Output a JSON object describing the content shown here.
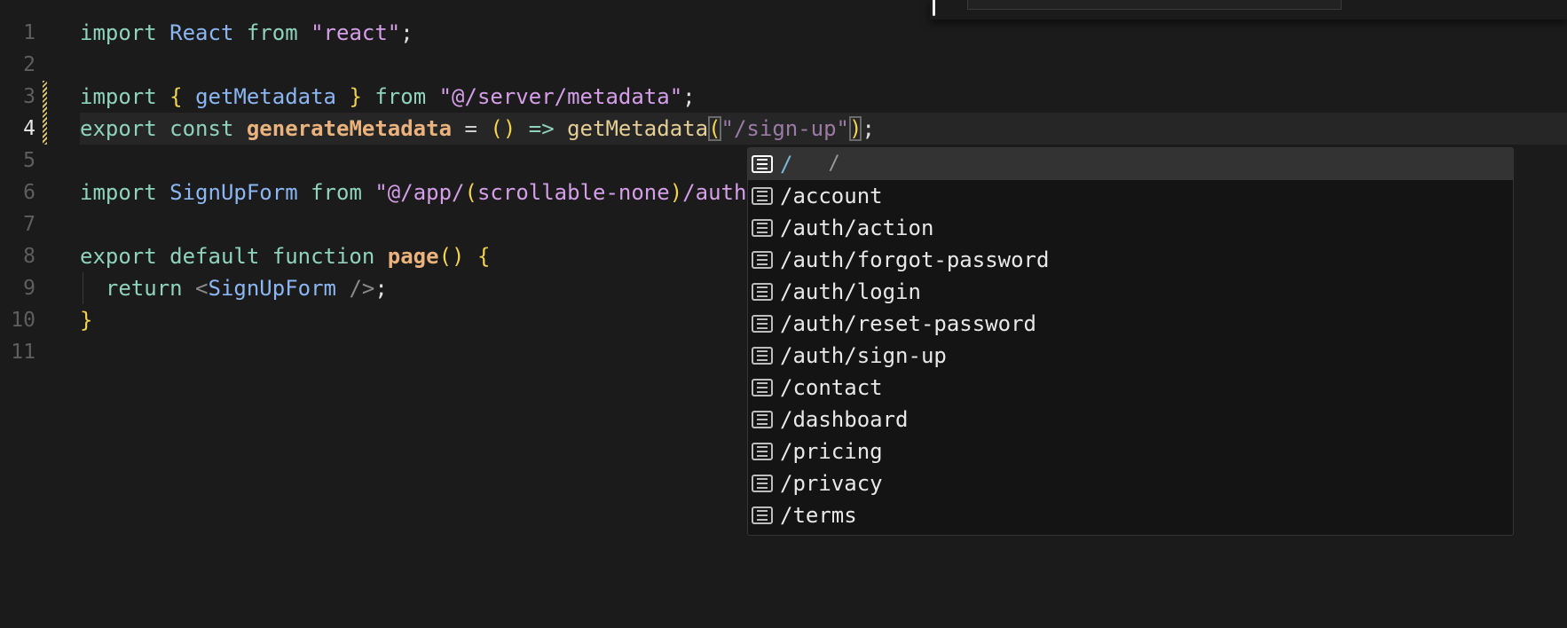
{
  "editor": {
    "line_numbers": [
      "1",
      "2",
      "3",
      "4",
      "5",
      "6",
      "7",
      "8",
      "9",
      "10",
      "11"
    ],
    "active_line": 4,
    "lines": [
      [
        {
          "t": "import ",
          "c": "kw"
        },
        {
          "t": "React ",
          "c": "id"
        },
        {
          "t": "from ",
          "c": "kw"
        },
        {
          "t": "\"react\"",
          "c": "str"
        },
        {
          "t": ";",
          "c": "pun"
        }
      ],
      [],
      [
        {
          "t": "import ",
          "c": "kw"
        },
        {
          "t": "{ ",
          "c": "br"
        },
        {
          "t": "getMetadata ",
          "c": "id"
        },
        {
          "t": "} ",
          "c": "br"
        },
        {
          "t": "from ",
          "c": "kw"
        },
        {
          "t": "\"@/server/metadata\"",
          "c": "str"
        },
        {
          "t": ";",
          "c": "pun"
        }
      ],
      [
        {
          "t": "export const ",
          "c": "kw"
        },
        {
          "t": "generateMetadata",
          "c": "fn"
        },
        {
          "t": " = ",
          "c": "op"
        },
        {
          "t": "() ",
          "c": "br"
        },
        {
          "t": "=> ",
          "c": "kw"
        },
        {
          "t": "getMetadata",
          "c": "call"
        },
        {
          "t": "(",
          "c": "br box"
        },
        {
          "t": "\"/sign-up\"",
          "c": "str-dim"
        },
        {
          "t": ")",
          "c": "br box"
        },
        {
          "t": ";",
          "c": "pun"
        }
      ],
      [],
      [
        {
          "t": "import ",
          "c": "kw"
        },
        {
          "t": "SignUpForm ",
          "c": "id"
        },
        {
          "t": "from ",
          "c": "kw"
        },
        {
          "t": "\"@/app/",
          "c": "str"
        },
        {
          "t": "(",
          "c": "br"
        },
        {
          "t": "scrollable-none",
          "c": "str"
        },
        {
          "t": ")",
          "c": "br"
        },
        {
          "t": "/auth",
          "c": "str"
        }
      ],
      [],
      [
        {
          "t": "export default function ",
          "c": "kw"
        },
        {
          "t": "page",
          "c": "fn"
        },
        {
          "t": "() ",
          "c": "br"
        },
        {
          "t": "{",
          "c": "br"
        }
      ],
      [
        {
          "t": "  return ",
          "c": "kw"
        },
        {
          "t": "<",
          "c": "tag"
        },
        {
          "t": "SignUpForm ",
          "c": "id"
        },
        {
          "t": "/>",
          "c": "tag"
        },
        {
          "t": ";",
          "c": "pun"
        }
      ],
      [
        {
          "t": "}",
          "c": "br"
        }
      ],
      []
    ]
  },
  "suggestions": {
    "icon": "text-document-icon",
    "selected": {
      "label": "/",
      "detail": "/"
    },
    "items": [
      "/account",
      "/auth/action",
      "/auth/forgot-password",
      "/auth/login",
      "/auth/reset-password",
      "/auth/sign-up",
      "/contact",
      "/dashboard",
      "/pricing",
      "/privacy",
      "/terms"
    ]
  },
  "colors": {
    "background": "#1b1b1b",
    "keyword": "#8fd3bd",
    "identifier": "#8bb6f2",
    "string": "#d59ee8",
    "function": "#eab37d",
    "bracket": "#f2d34f"
  }
}
